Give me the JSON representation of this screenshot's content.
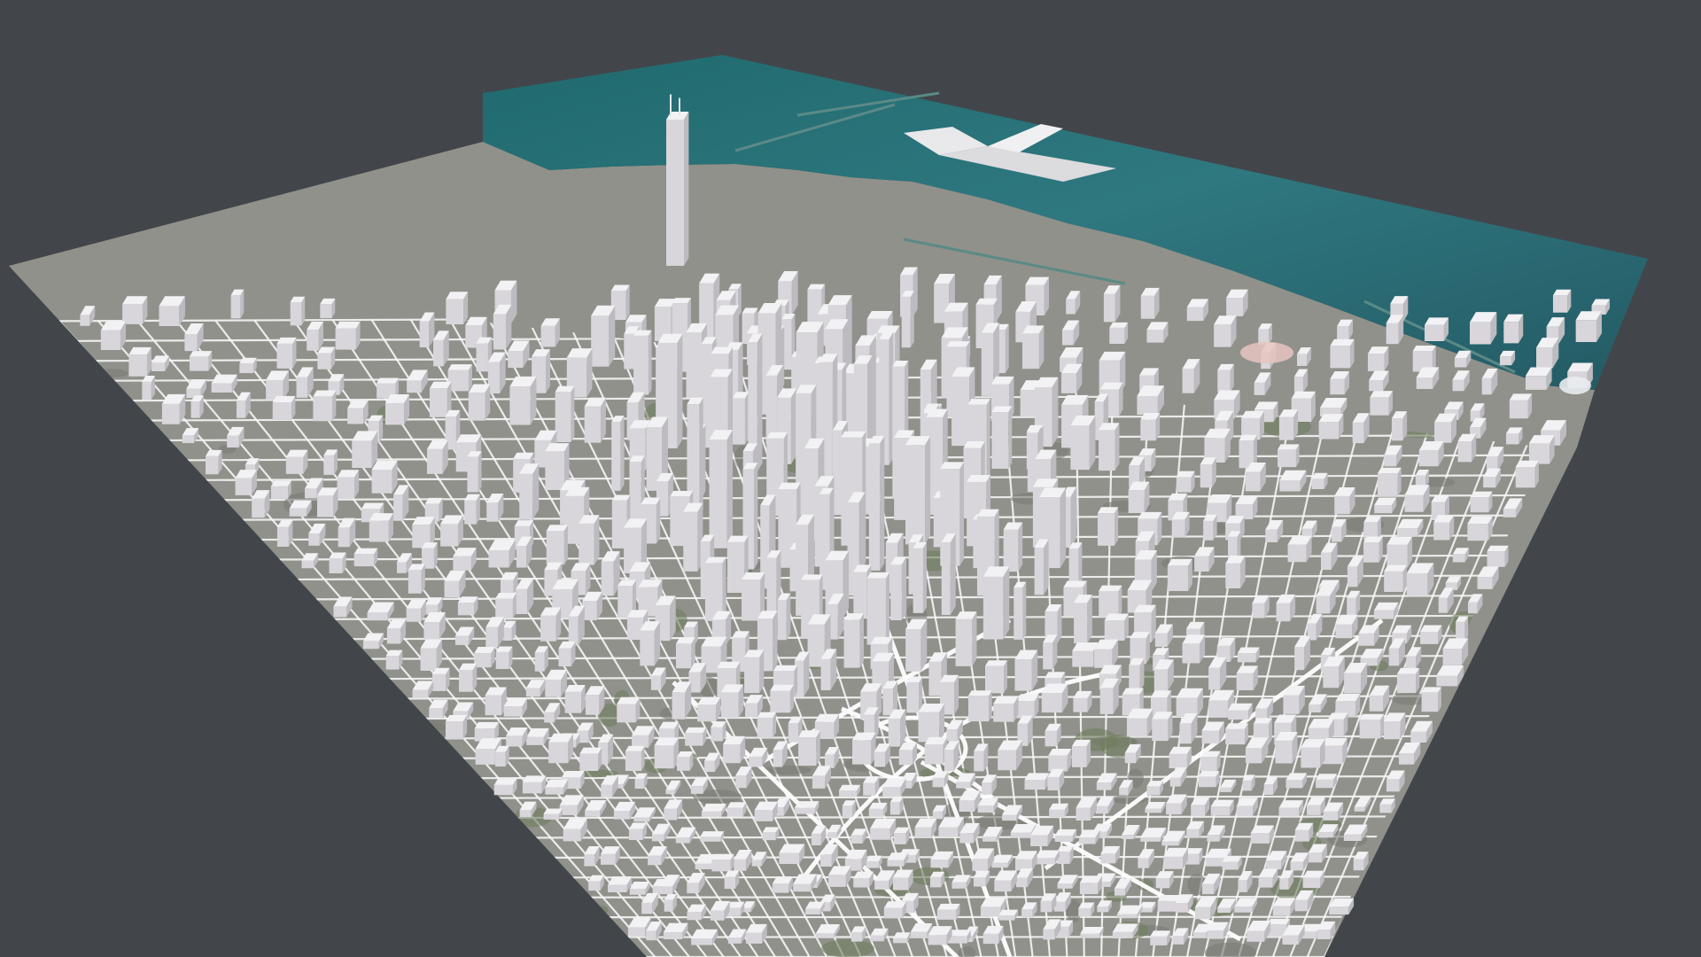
{
  "viewport": {
    "background_color": "#42464a",
    "cursor": "grab"
  },
  "scene": {
    "model": "3d-city-model",
    "water_color": "#2e6b74",
    "building_color": "#e6e4e6",
    "road_color": "#f7f7f7",
    "ground_color": "#8d8f86"
  }
}
